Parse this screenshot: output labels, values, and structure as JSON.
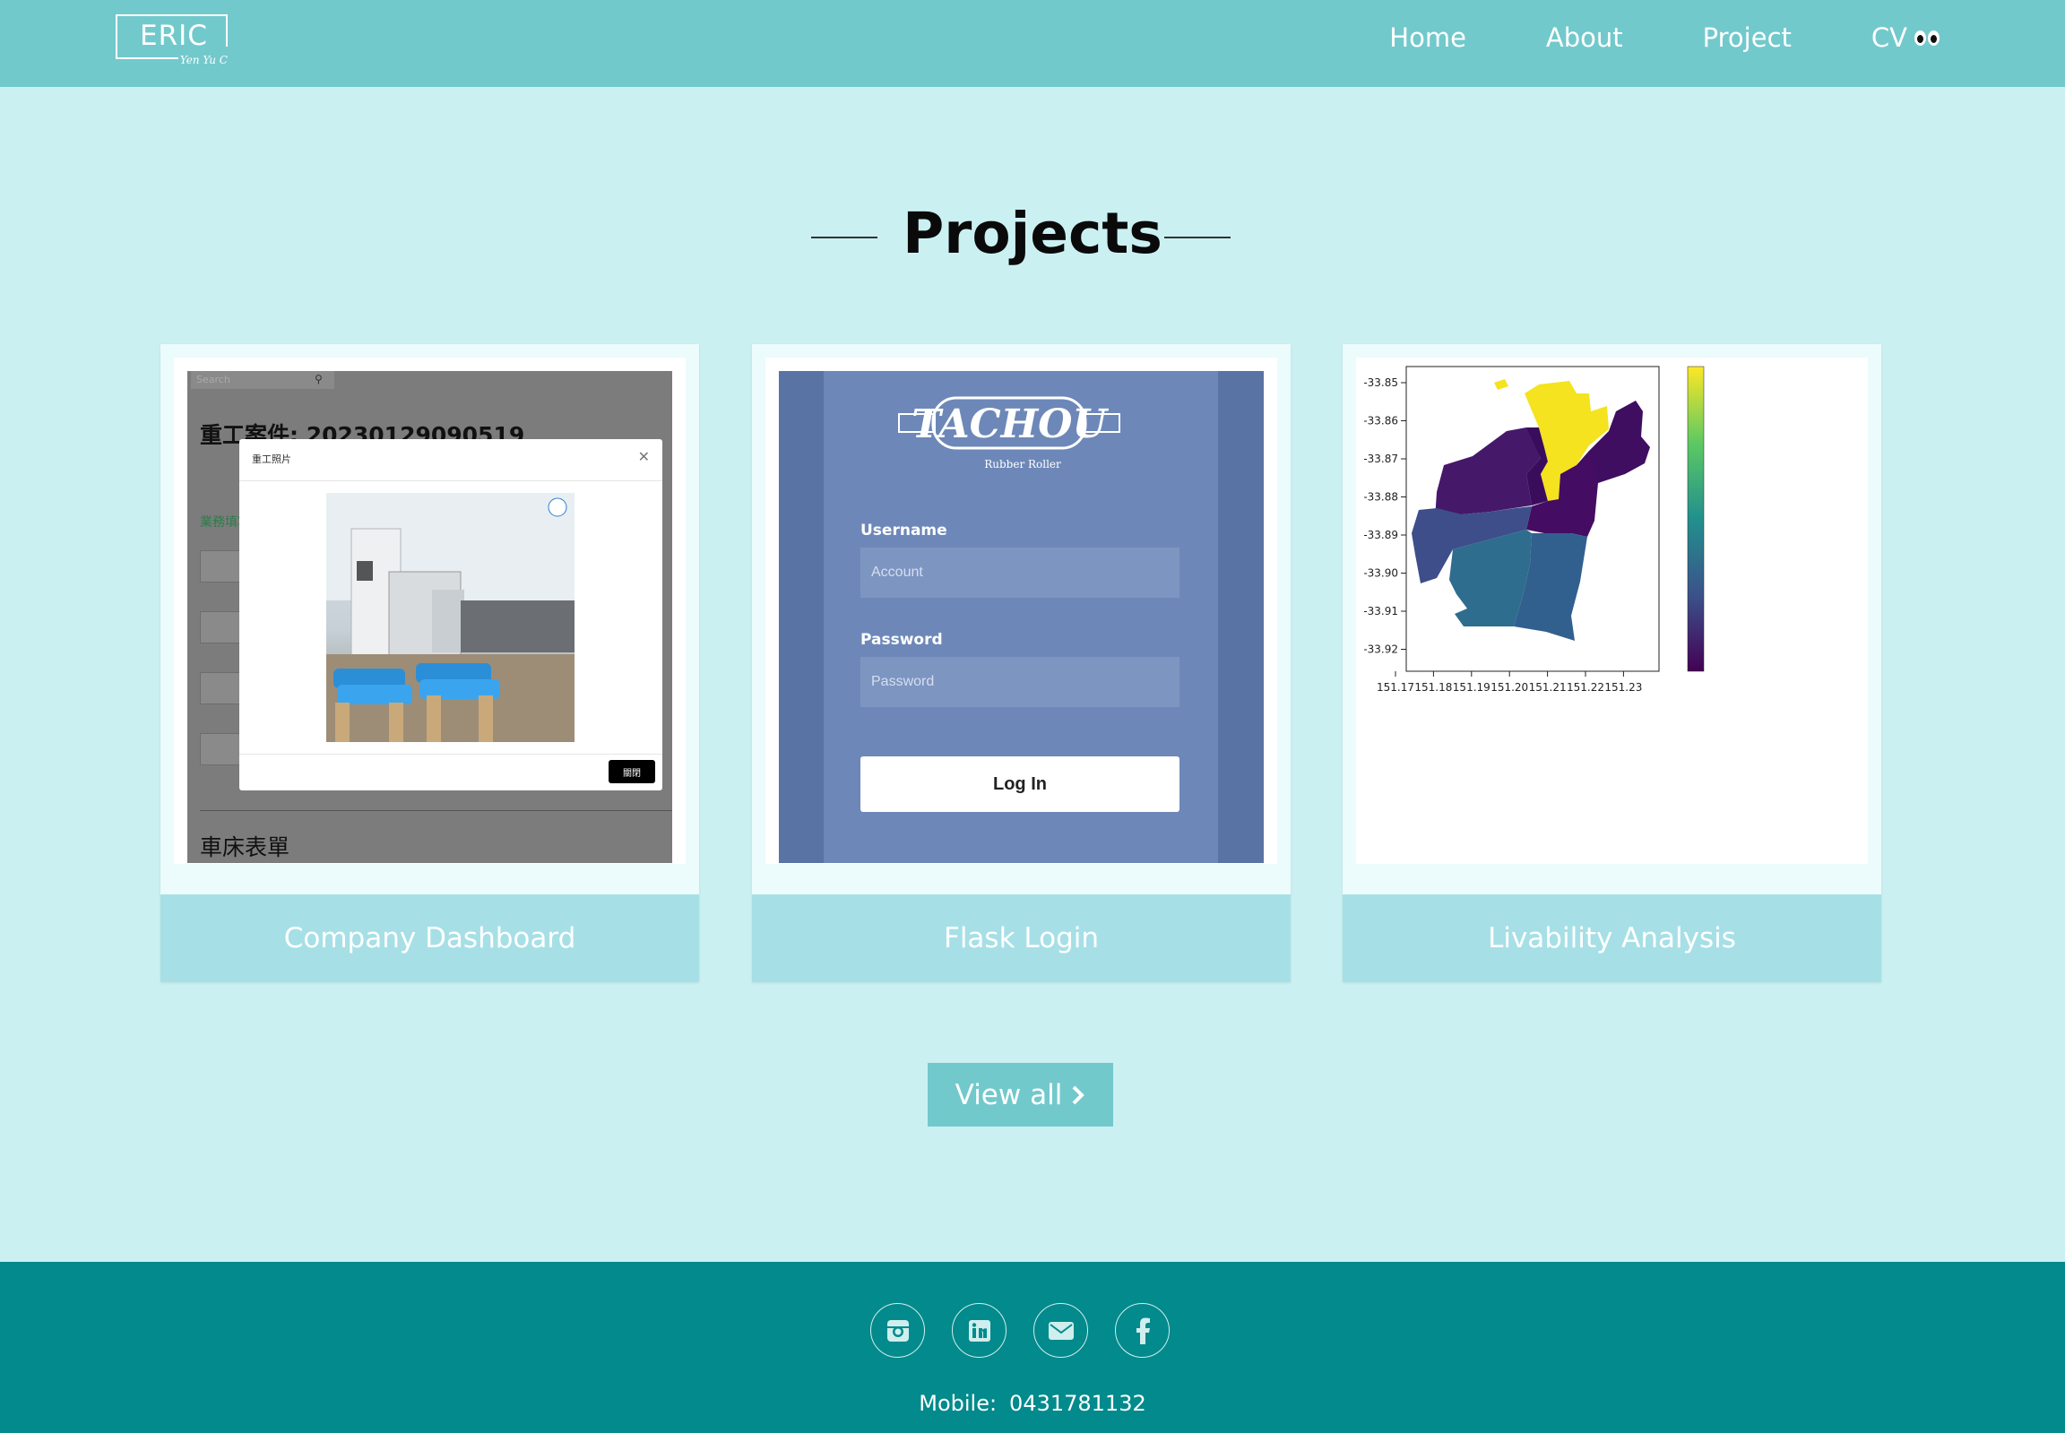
{
  "nav": {
    "logo": "ERIC",
    "logo_script": "Yen Yu C",
    "links": [
      "Home",
      "About",
      "Project",
      "CV"
    ]
  },
  "section": {
    "title": "Projects"
  },
  "projects": [
    {
      "caption": "Company Dashboard",
      "dashboard": {
        "search_placeholder": "Search",
        "heading": "重工案件: 20230129090519",
        "subheading": "車床表單",
        "green_text": "業務填寫",
        "modal_title": "重工照片",
        "modal_button": "關閉"
      }
    },
    {
      "caption": "Flask Login",
      "login": {
        "brand": "TACHOU",
        "brand_sub": "Rubber Roller",
        "username_label": "Username",
        "username_placeholder": "Account",
        "password_label": "Password",
        "password_placeholder": "Password",
        "button": "Log In"
      }
    },
    {
      "caption": "Livability Analysis",
      "map": {
        "y_ticks": [
          "-33.85",
          "-33.86",
          "-33.87",
          "-33.88",
          "-33.89",
          "-33.90",
          "-33.91",
          "-33.92"
        ],
        "x_ticks": [
          "151.17",
          "151.18",
          "151.19",
          "151.20",
          "151.21",
          "151.22",
          "151.23"
        ],
        "colormap": "viridis"
      }
    }
  ],
  "view_all": "View all",
  "footer": {
    "mobile_label": "Mobile:",
    "mobile_number": "0431781132",
    "socials": [
      "instagram-icon",
      "linkedin-icon",
      "mail-icon",
      "facebook-icon"
    ]
  },
  "colors": {
    "nav": "#72c9cc",
    "page_bg": "#cbf0f2",
    "caption_bg": "#a6e0e6",
    "footer": "#028a8c"
  }
}
